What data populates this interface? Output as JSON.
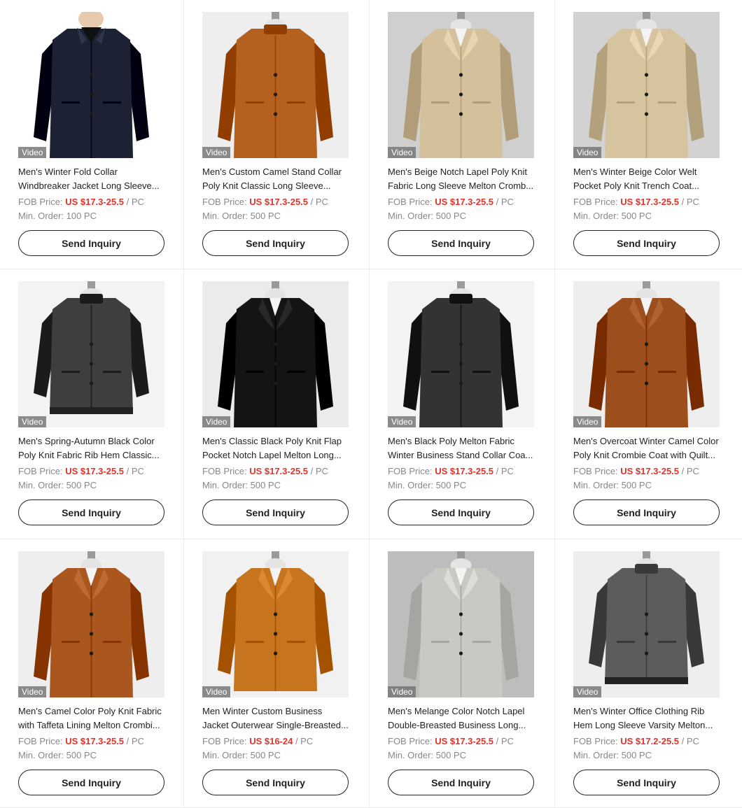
{
  "video_badge": "Video",
  "price_prefix": "FOB Price: ",
  "price_suffix": " / PC",
  "moq_prefix": "Min. Order: ",
  "button_label": "Send Inquiry",
  "products": [
    {
      "title1": "Men's Winter Fold Collar",
      "title2": "Windbreaker Jacket Long Sleeve...",
      "price": "US $17.3-25.5",
      "moq": "100 PC",
      "image": {
        "bg": "#ffffff",
        "coat": "#1c2233",
        "style": "model",
        "collar": "shirt"
      }
    },
    {
      "title1": "Men's Custom Camel Stand Collar",
      "title2": "Poly Knit Classic Long Sleeve...",
      "price": "US $17.3-25.5",
      "moq": "500 PC",
      "image": {
        "bg": "#eeeeee",
        "coat": "#b4601f",
        "style": "long",
        "collar": "stand"
      }
    },
    {
      "title1": "Men's Beige Notch Lapel Poly Knit",
      "title2": "Fabric Long Sleeve Melton Cromb...",
      "price": "US $17.3-25.5",
      "moq": "500 PC",
      "image": {
        "bg": "#cfcfcf",
        "coat": "#d4c09a",
        "style": "long",
        "collar": "notch"
      }
    },
    {
      "title1": "Men's Winter Beige Color Welt",
      "title2": "Pocket Poly Knit Trench Coat...",
      "price": "US $17.3-25.5",
      "moq": "500 PC",
      "image": {
        "bg": "#d2d2d2",
        "coat": "#d6c49e",
        "style": "long",
        "collar": "notch"
      }
    },
    {
      "title1": "Men's Spring-Autumn Black Color",
      "title2": "Poly Knit Fabric Rib Hem Classic...",
      "price": "US $17.3-25.5",
      "moq": "500 PC",
      "image": {
        "bg": "#f3f3f3",
        "coat": "#3e3e3e",
        "style": "jacket",
        "collar": "stand"
      }
    },
    {
      "title1": "Men's Classic Black Poly Knit Flap",
      "title2": "Pocket Notch Lapel Melton Long...",
      "price": "US $17.3-25.5",
      "moq": "500 PC",
      "image": {
        "bg": "#ebebeb",
        "coat": "#141414",
        "style": "long",
        "collar": "notch"
      }
    },
    {
      "title1": "Men's Black Poly Melton Fabric",
      "title2": "Winter Business Stand Collar Coa...",
      "price": "US $17.3-25.5",
      "moq": "500 PC",
      "image": {
        "bg": "#f3f3f3",
        "coat": "#333333",
        "style": "long",
        "collar": "stand"
      }
    },
    {
      "title1": "Men's Overcoat Winter Camel Color",
      "title2": "Poly Knit Crombie Coat with Quilt...",
      "price": "US $17.3-25.5",
      "moq": "500 PC",
      "image": {
        "bg": "#eeeeee",
        "coat": "#9c4e1c",
        "style": "long",
        "collar": "notch"
      }
    },
    {
      "title1": "Men's Camel Color Poly Knit Fabric",
      "title2": "with Taffeta Lining Melton Crombi...",
      "price": "US $17.3-25.5",
      "moq": "500 PC",
      "image": {
        "bg": "#eeeeee",
        "coat": "#a9561f",
        "style": "long",
        "collar": "notch"
      }
    },
    {
      "title1": "Men Winter Custom Business",
      "title2": "Jacket Outerwear Single-Breasted...",
      "price": "US $16-24",
      "moq": "500 PC",
      "image": {
        "bg": "#f1f1f1",
        "coat": "#c7741f",
        "style": "mid",
        "collar": "notch"
      }
    },
    {
      "title1": "Men's Melange Color Notch Lapel",
      "title2": "Double-Breasted Business Long...",
      "price": "US $17.3-25.5",
      "moq": "500 PC",
      "image": {
        "bg": "#bdbdbd",
        "coat": "#c9c9c4",
        "style": "long",
        "collar": "notch"
      }
    },
    {
      "title1": "Men's Winter Office Clothing Rib",
      "title2": "Hem Long Sleeve Varsity Melton...",
      "price": "US $17.2-25.5",
      "moq": "500 PC",
      "image": {
        "bg": "#eeeeee",
        "coat": "#5c5c5c",
        "style": "jacket",
        "collar": "stand"
      }
    }
  ]
}
